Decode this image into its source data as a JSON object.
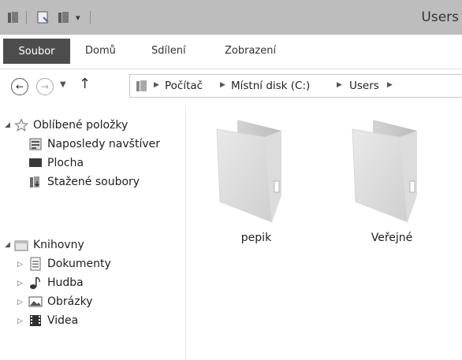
{
  "window": {
    "title": "Users"
  },
  "ribbon": {
    "tabs": [
      "Soubor",
      "Domů",
      "Sdílení",
      "Zobrazení"
    ],
    "active_tab": "Soubor"
  },
  "address": {
    "breadcrumb": [
      "Počítač",
      "Místní disk (C:)",
      "Users"
    ]
  },
  "nav": {
    "favorites_label": "Oblíbené položky",
    "favorites": [
      "Naposledy navštíver",
      "Plocha",
      "Stažené soubory"
    ],
    "libraries_label": "Knihovny",
    "libraries": [
      "Dokumenty",
      "Hudba",
      "Obrázky",
      "Videa"
    ]
  },
  "content": {
    "folders": [
      "pepik",
      "Veřejné"
    ]
  },
  "colors": {
    "titlebar": "#bdbdbd",
    "file_tab": "#4d4d4d"
  },
  "icons": {
    "star": "star-icon",
    "library": "library-icon",
    "folder": "folder-icon"
  }
}
